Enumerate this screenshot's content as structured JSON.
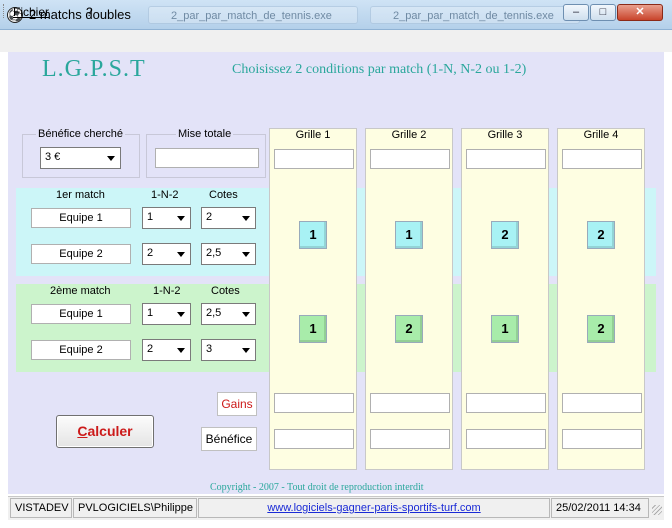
{
  "window": {
    "title": "2 matchs doubles",
    "icon": "soccer-ball-icon",
    "taskbar_ghosts": [
      "2_par_par_match_de_tennis.exe",
      "2_par_par_match_de_tennis.exe",
      "2_par_par_match_de_tennis.exe"
    ],
    "min_glyph": "‒",
    "max_glyph": "□",
    "close_glyph": "✕"
  },
  "menu": {
    "items": [
      "Fichier",
      "?"
    ]
  },
  "header": {
    "brand": "L.G.P.S.T",
    "instruction": "Choisissez 2 conditions par match (1-N,  N-2 ou 1-2)"
  },
  "benefit": {
    "label": "Bénéfice cherché",
    "value": "3 €"
  },
  "stake": {
    "label": "Mise totale",
    "value": ""
  },
  "match1": {
    "label": "1er match",
    "col_1n2": "1-N-2",
    "col_cotes": "Cotes",
    "team1": {
      "name": "Equipe 1",
      "pick": "1",
      "cote": "2"
    },
    "team2": {
      "name": "Equipe 2",
      "pick": "2",
      "cote": "2,5"
    }
  },
  "match2": {
    "label": "2ème  match",
    "col_1n2": "1-N-2",
    "col_cotes": "Cotes",
    "team1": {
      "name": "Equipe 1",
      "pick": "1",
      "cote": "2,5"
    },
    "team2": {
      "name": "Equipe 2",
      "pick": "2",
      "cote": "3"
    }
  },
  "grilles": [
    {
      "title": "Grille 1",
      "match1": "1",
      "match2": "1"
    },
    {
      "title": "Grille 2",
      "match1": "1",
      "match2": "2"
    },
    {
      "title": "Grille 3",
      "match1": "2",
      "match2": "1"
    },
    {
      "title": "Grille 4",
      "match1": "2",
      "match2": "2"
    }
  ],
  "results": {
    "gains_label": "Gains",
    "benefice_label": "Bénéfice"
  },
  "calculate": {
    "hotkey": "C",
    "rest": "alculer"
  },
  "footer": {
    "copyright": "Copyright - 2007 - Tout droit de reproduction interdit"
  },
  "status": {
    "machine": "VISTADEV",
    "user": "PVLOGICIELS\\Philippe",
    "link": "www.logiciels-gagner-paris-sportifs-turf.com",
    "datetime": "25/02/2011 14:34"
  },
  "colors": {
    "accent_teal": "#2aa79c",
    "match1_band": "#ccf6f8",
    "match2_band": "#ccf4cc",
    "grille_bg": "#fefee2",
    "calc_text": "#cc1a1a",
    "gains_text": "#cc1a1a"
  }
}
